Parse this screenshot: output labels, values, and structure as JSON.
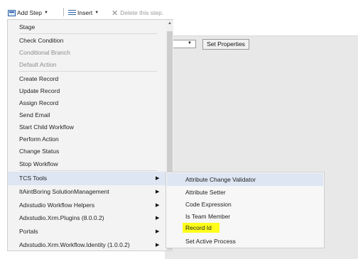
{
  "toolbar": {
    "add_step_label": "Add Step",
    "insert_label": "Insert",
    "delete_label": "Delete this step."
  },
  "background": {
    "button_label": "Set Properties"
  },
  "menu": {
    "items": [
      {
        "label": "Stage"
      },
      {
        "label": "Check Condition"
      },
      {
        "label": "Conditional Branch"
      },
      {
        "label": "Default Action"
      },
      {
        "label": "Create Record"
      },
      {
        "label": "Update Record"
      },
      {
        "label": "Assign Record"
      },
      {
        "label": "Send Email"
      },
      {
        "label": "Start Child Workflow"
      },
      {
        "label": "Perform Action"
      },
      {
        "label": "Change Status"
      },
      {
        "label": "Stop Workflow"
      },
      {
        "label": "TCS Tools"
      },
      {
        "label": "ItAintBoring SolutionManagement"
      },
      {
        "label": "Adxstudio Workflow Helpers"
      },
      {
        "label": "Adxstudio.Xrm.Plugins (8.0.0.2)"
      },
      {
        "label": "Portals"
      },
      {
        "label": "Adxstudio.Xrm.Workflow.Identity (1.0.0.2)"
      }
    ]
  },
  "submenu": {
    "items": [
      {
        "label": "Attribute Change Validator"
      },
      {
        "label": "Attribute Setter"
      },
      {
        "label": "Code Expression"
      },
      {
        "label": "Is Team Member"
      },
      {
        "label": "Record Id"
      },
      {
        "label": "Set Active Process"
      }
    ]
  },
  "colors": {
    "hover_background": "#dde6f2",
    "marker_highlight": "#ffff1a",
    "disabled_text": "#8c8c8c"
  },
  "icons": [
    "add-step-icon",
    "insert-icon",
    "delete-icon",
    "chevron-down-icon",
    "chevron-right-icon",
    "scroll-up-arrow-icon"
  ]
}
